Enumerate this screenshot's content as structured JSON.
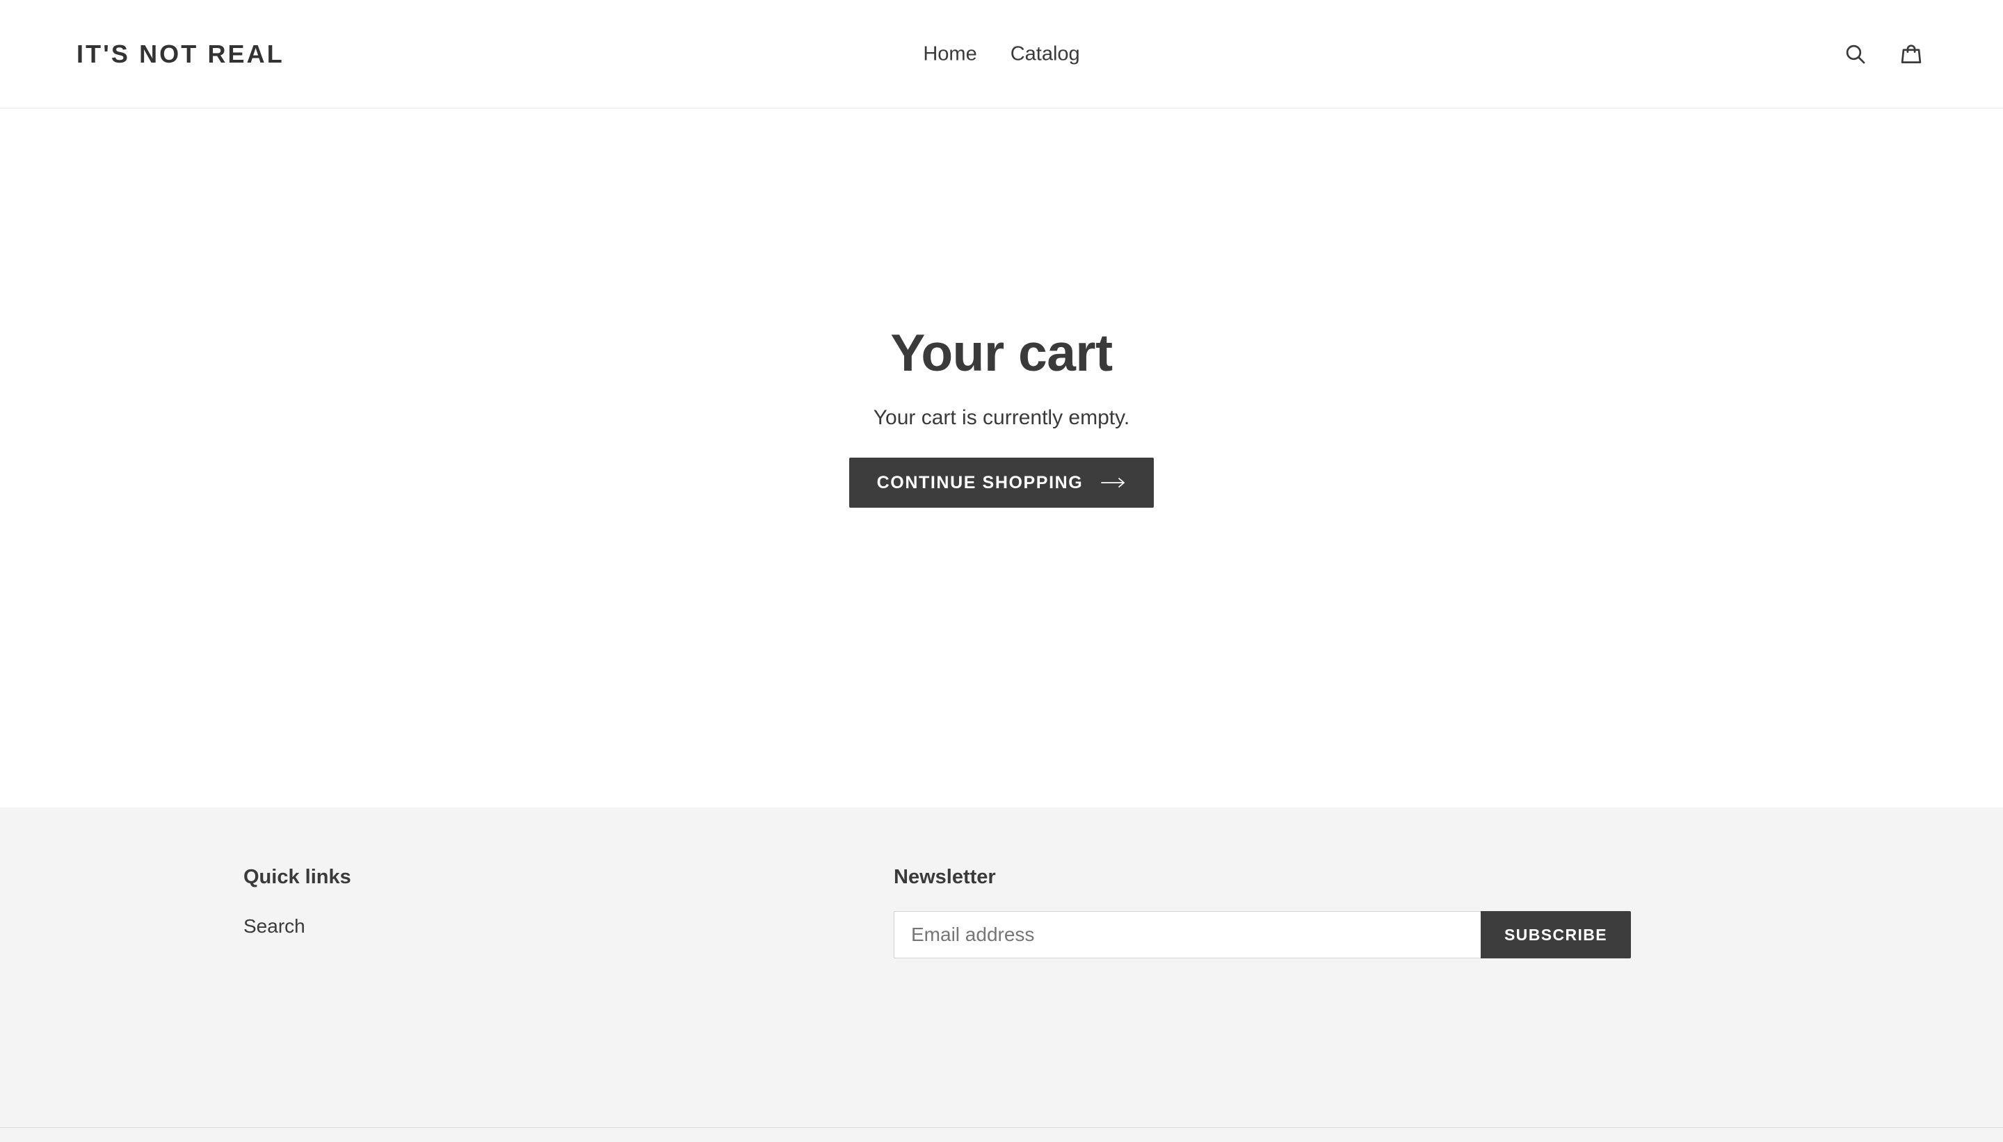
{
  "header": {
    "logo": "IT'S NOT REAL",
    "nav": [
      {
        "label": "Home"
      },
      {
        "label": "Catalog"
      }
    ],
    "icons": {
      "search_label": "Search",
      "cart_label": "Cart"
    }
  },
  "main": {
    "title": "Your cart",
    "empty_message": "Your cart is currently empty.",
    "continue_shopping_label": "CONTINUE SHOPPING",
    "continue_shopping_arrow": "→"
  },
  "footer": {
    "quick_links": {
      "heading": "Quick links",
      "items": [
        {
          "label": "Search"
        }
      ]
    },
    "newsletter": {
      "heading": "Newsletter",
      "email_placeholder": "Email address",
      "email_value": "",
      "submit_label": "SUBSCRIBE"
    }
  },
  "colors": {
    "text": "#3a3a3a",
    "button_bg": "#3d3d3d",
    "footer_bg": "#f4f4f4",
    "border": "#ebebeb"
  }
}
